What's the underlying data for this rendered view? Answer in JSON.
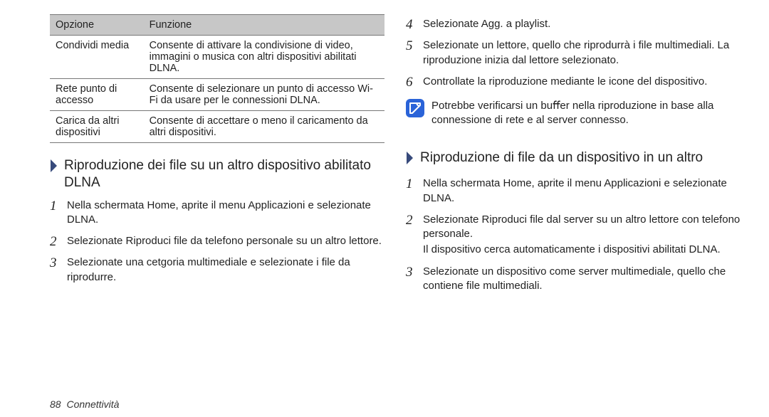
{
  "table": {
    "header": {
      "col1": "Opzione",
      "col2": "Funzione"
    },
    "rows": [
      {
        "opt": "Condividi media",
        "func": "Consente di attivare la condivisione di video, immagini o musica con altri dispositivi abilitati DLNA."
      },
      {
        "opt": "Rete punto di accesso",
        "func": "Consente di selezionare un punto di accesso Wi-Fi da usare per le connessioni DLNA."
      },
      {
        "opt": "Carica da altri dispositivi",
        "func": "Consente di accettare o meno il caricamento da altri dispositivi."
      }
    ]
  },
  "sectionA": {
    "title": "Riproduzione dei ﬁle su un altro dispositivo abilitato DLNA",
    "steps": [
      "Nella schermata Home, aprite il menu Applicazioni e selezionate DLNA.",
      "Selezionate Riproduci ﬁle da telefono personale su un altro lettore.",
      "Selezionate una cetgoria multimediale e selezionate i ﬁle da riprodurre."
    ]
  },
  "topSteps": [
    "Selezionate Agg. a playlist.",
    "Selezionate un lettore, quello che riprodurrà i ﬁle multimediali. La riproduzione inizia dal lettore selezionato.",
    "Controllate la riproduzione mediante le icone del dispositivo."
  ],
  "note": "Potrebbe veriﬁcarsi un buﬀer nella riproduzione in base alla connessione di rete e al server connesso.",
  "sectionB": {
    "title": "Riproduzione di ﬁle da un dispositivo in un altro",
    "step1": "Nella schermata Home, aprite il menu Applicazioni e selezionate DLNA.",
    "step2": "Selezionate Riproduci ﬁle dal server su un altro lettore con telefono personale.",
    "sub2": "Il dispositivo cerca automaticamente i dispositivi abilitati DLNA.",
    "step3": "Selezionate un dispositivo come server multimediale, quello che contiene ﬁle multimediali."
  },
  "footer": {
    "page": "88",
    "section": "Connettività"
  }
}
